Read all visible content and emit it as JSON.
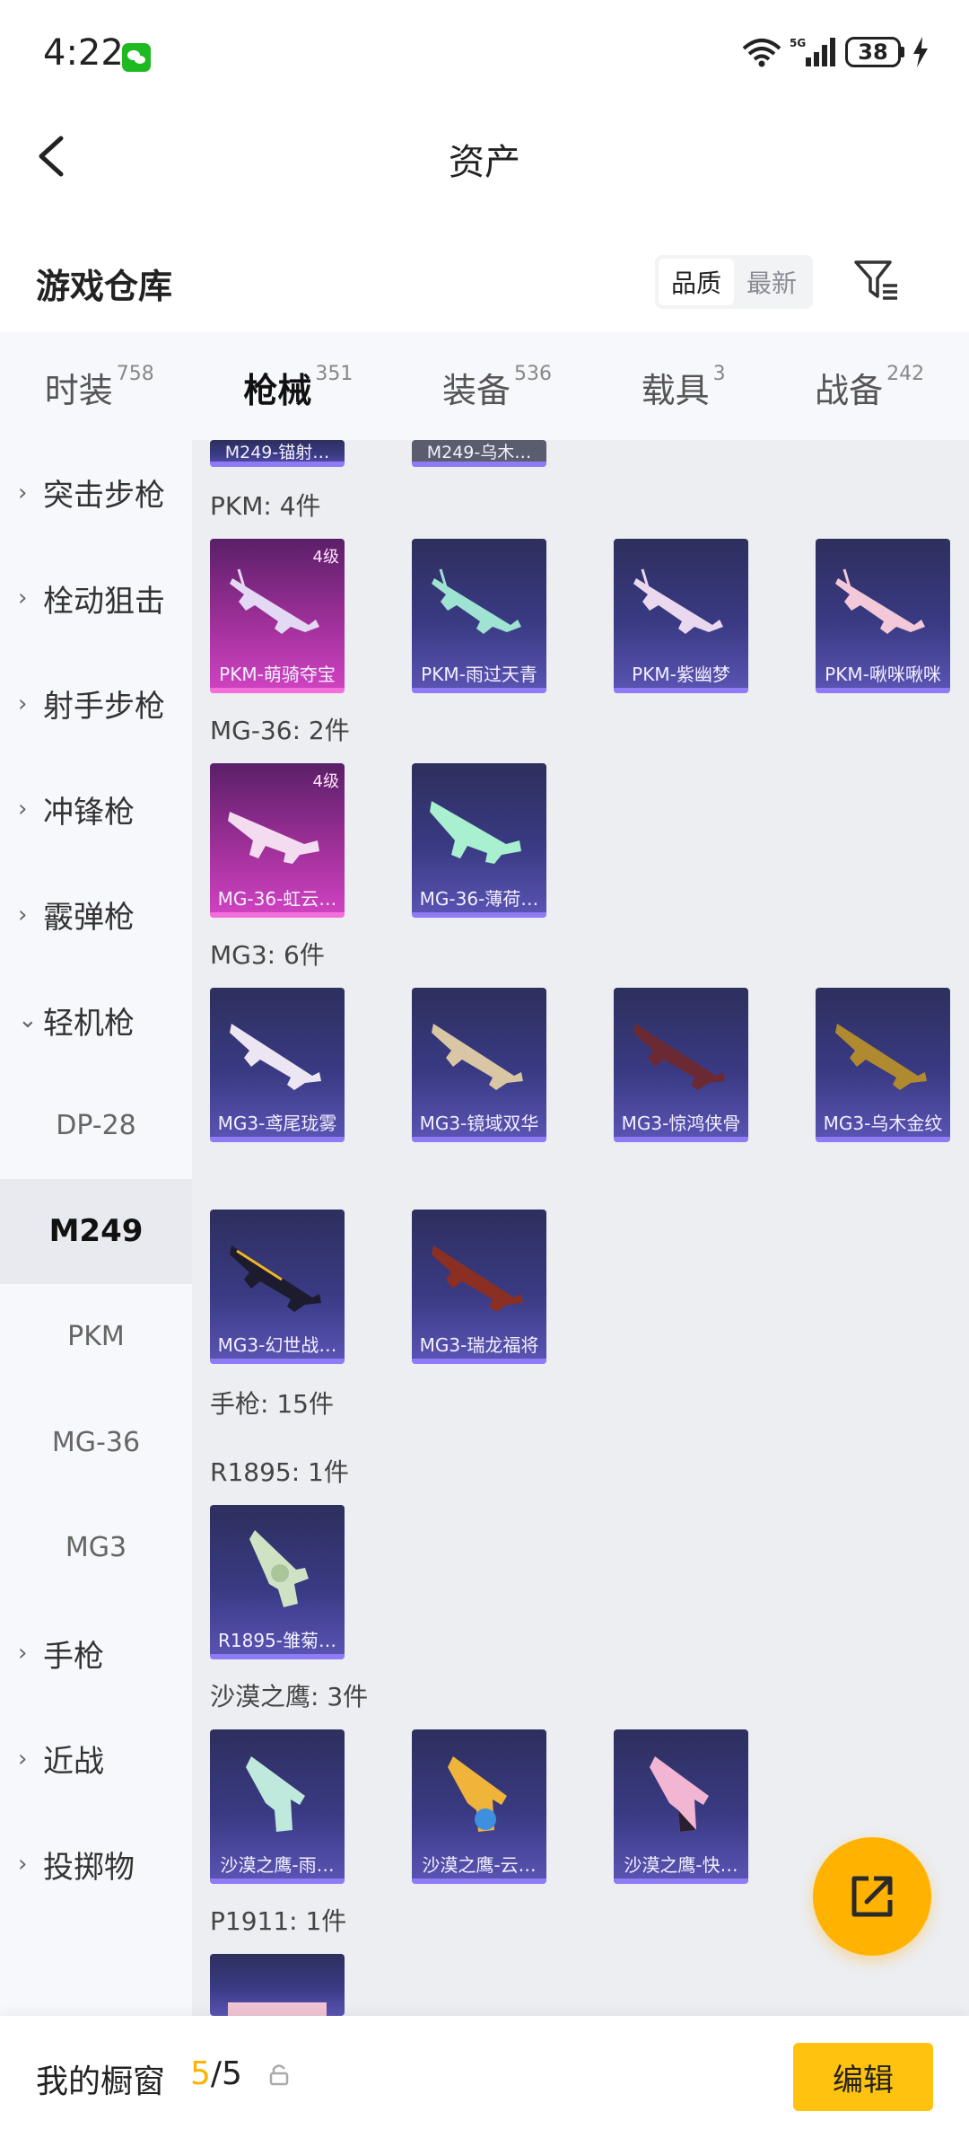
{
  "status_bar": {
    "time": "4:22",
    "battery": "38"
  },
  "nav": {
    "title": "资产"
  },
  "warehouse": {
    "title": "游戏仓库",
    "sort_options": [
      "品质",
      "最新"
    ],
    "active_sort": "品质"
  },
  "tabs": [
    {
      "label": "时装",
      "count": "758"
    },
    {
      "label": "枪械",
      "count": "351"
    },
    {
      "label": "装备",
      "count": "536"
    },
    {
      "label": "载具",
      "count": "3"
    },
    {
      "label": "战备",
      "count": "242"
    }
  ],
  "active_tab": "枪械",
  "sidebar": {
    "categories": [
      "突击步枪",
      "栓动狙击",
      "射手步枪",
      "冲锋枪",
      "霰弹枪",
      "轻机枪"
    ],
    "lmg_subitems": [
      "DP-28",
      "M249",
      "PKM",
      "MG-36",
      "MG3"
    ],
    "active_subitem": "M249",
    "more_categories": [
      "手枪",
      "近战",
      "投掷物"
    ]
  },
  "content": {
    "m249_partial": [
      "M249-锚射…",
      "M249-乌木…"
    ],
    "pkm": {
      "label": "PKM: 4件",
      "items": [
        {
          "name": "PKM-萌骑夺宝",
          "tier": "4级",
          "rarity": "pink"
        },
        {
          "name": "PKM-雨过天青",
          "tier": "",
          "rarity": "purple"
        },
        {
          "name": "PKM-紫幽梦",
          "tier": "",
          "rarity": "purple"
        },
        {
          "name": "PKM-啾咪啾咪",
          "tier": "",
          "rarity": "purple"
        }
      ]
    },
    "mg36": {
      "label": "MG-36: 2件",
      "items": [
        {
          "name": "MG-36-虹云…",
          "tier": "4级",
          "rarity": "pink"
        },
        {
          "name": "MG-36-薄荷…",
          "tier": "",
          "rarity": "purple"
        }
      ]
    },
    "mg3": {
      "label": "MG3: 6件",
      "items": [
        {
          "name": "MG3-鸢尾珑雾",
          "tier": "",
          "rarity": "purple"
        },
        {
          "name": "MG3-镜域双华",
          "tier": "",
          "rarity": "purple"
        },
        {
          "name": "MG3-惊鸿侠骨",
          "tier": "",
          "rarity": "purple"
        },
        {
          "name": "MG3-乌木金纹",
          "tier": "",
          "rarity": "purple"
        },
        {
          "name": "MG3-幻世战…",
          "tier": "",
          "rarity": "purple"
        },
        {
          "name": "MG3-瑞龙福将",
          "tier": "",
          "rarity": "purple"
        }
      ]
    },
    "pistol_header": "手枪: 15件",
    "r1895": {
      "label": "R1895: 1件",
      "items": [
        {
          "name": "R1895-雏菊…",
          "tier": "",
          "rarity": "purple"
        }
      ]
    },
    "deagle": {
      "label": "沙漠之鹰: 3件",
      "items": [
        {
          "name": "沙漠之鹰-雨…",
          "tier": "",
          "rarity": "purple"
        },
        {
          "name": "沙漠之鹰-云…",
          "tier": "",
          "rarity": "purple"
        },
        {
          "name": "沙漠之鹰-快…",
          "tier": "",
          "rarity": "purple"
        }
      ]
    },
    "p1911": {
      "label": "P1911: 1件"
    }
  },
  "bottom_bar": {
    "showcase_label": "我的橱窗",
    "showcase_current": "5",
    "showcase_total": "/5",
    "edit_label": "编辑"
  },
  "colors": {
    "accent": "#ffb300",
    "card_purple": "#3a3a84",
    "card_pink": "#a0309a"
  }
}
